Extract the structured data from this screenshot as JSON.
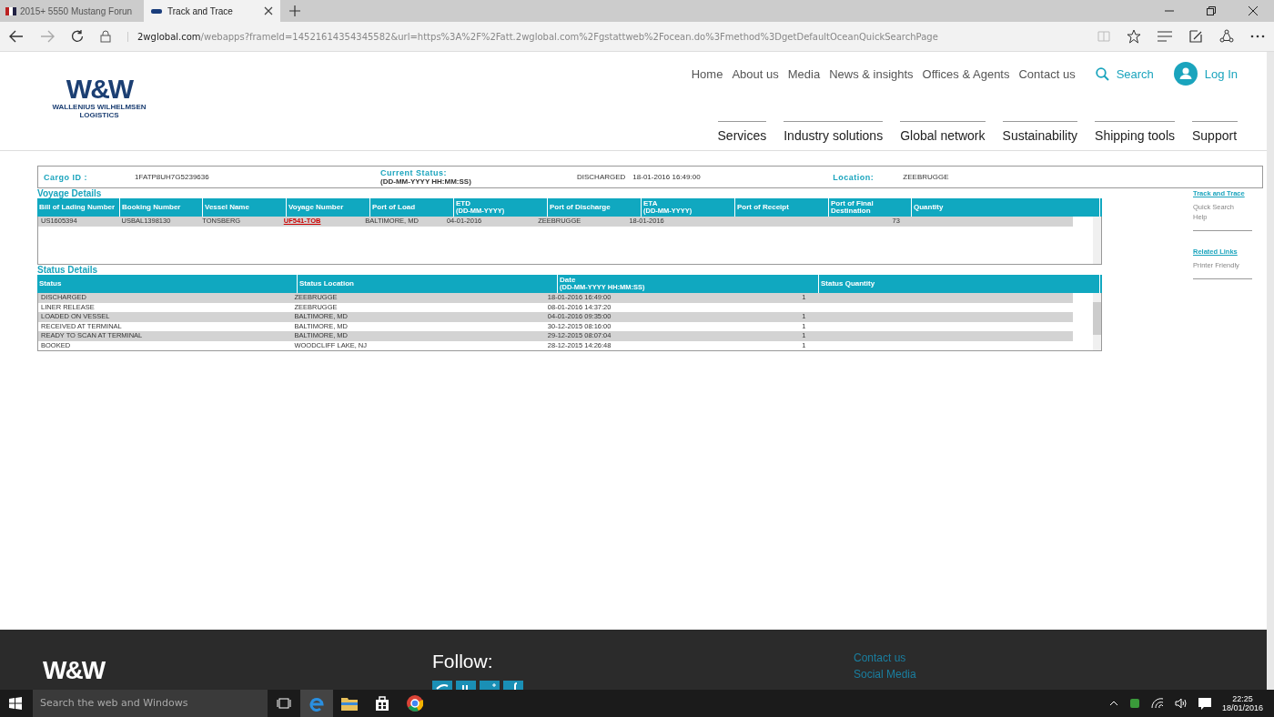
{
  "browser": {
    "tabs": [
      {
        "title": "2015+ 5550 Mustang Forun",
        "selected": false
      },
      {
        "title": "Track and Trace",
        "selected": true
      }
    ],
    "address": {
      "domain": "2wglobal.com",
      "path": "/webapps?frameId=14521614354345582&url=https%3A%2F%2Fatt.2wglobal.com%2Fgstattweb%2Focean.do%3Fmethod%3DgetDefaultOceanQuickSearchPage"
    }
  },
  "header": {
    "logo": {
      "mark": "W&W",
      "name": "WALLENIUS WILHELMSEN",
      "sub": "LOGISTICS"
    },
    "top_nav": [
      "Home",
      "About us",
      "Media",
      "News & insights",
      "Offices & Agents",
      "Contact us"
    ],
    "search": "Search",
    "login": "Log In",
    "main_nav": [
      "Services",
      "Industry solutions",
      "Global network",
      "Sustainability",
      "Shipping tools",
      "Support"
    ]
  },
  "summary": {
    "cargo_label": "Cargo ID :",
    "cargo_id": "1FATP8UH7G5239636",
    "status_label": "Current Status:",
    "status_format": "(DD-MM-YYYY HH:MM:SS)",
    "status": "DISCHARGED",
    "status_date": "18-01-2016 16:49:00",
    "location_label": "Location:",
    "location": "ZEEBRUGGE"
  },
  "voyage": {
    "title": "Voyage  Details",
    "columns": [
      {
        "label": "Bill of Lading Number"
      },
      {
        "label": "Booking  Number"
      },
      {
        "label": "Vessel  Name"
      },
      {
        "label": "Voyage  Number"
      },
      {
        "label": "Port of Load"
      },
      {
        "label": "ETD",
        "sub": "(DD-MM-YYYY)"
      },
      {
        "label": "Port of  Discharge"
      },
      {
        "label": "ETA",
        "sub": "(DD-MM-YYYY)"
      },
      {
        "label": "Port of  Receipt"
      },
      {
        "label": "Port of Final Destination"
      },
      {
        "label": "Quantity"
      }
    ],
    "rows": [
      [
        {
          "text": "US1605394"
        },
        {
          "text": "USBAL1398130"
        },
        {
          "text": "TONSBERG"
        },
        {
          "text": "UF541-TOB",
          "kind": "link"
        },
        {
          "text": "BALTIMORE, MD"
        },
        {
          "text": "04-01-2016"
        },
        {
          "text": "ZEEBRUGGE"
        },
        {
          "text": "18-01-2016"
        },
        {
          "text": ""
        },
        {
          "text": ""
        },
        {
          "text": "73"
        }
      ]
    ]
  },
  "status": {
    "title": "Status Details",
    "columns": [
      {
        "label": "Status"
      },
      {
        "label": "Status Location"
      },
      {
        "label": "Date",
        "sub": "(DD-MM-YYYY HH:MM:SS)"
      },
      {
        "label": "Status Quantity"
      }
    ],
    "rows": [
      [
        "DISCHARGED",
        "ZEEBRUGGE",
        "18-01-2016 16:49:00",
        "1"
      ],
      [
        "LINER RELEASE",
        "ZEEBRUGGE",
        "08-01-2016 14:37:20",
        ""
      ],
      [
        "LOADED ON VESSEL",
        "BALTIMORE, MD",
        "04-01-2016 09:35:00",
        "1"
      ],
      [
        "RECEIVED AT TERMINAL",
        "BALTIMORE, MD",
        "30-12-2015 08:16:00",
        "1"
      ],
      [
        "READY TO SCAN AT TERMINAL",
        "BALTIMORE, MD",
        "29-12-2015 08:07:04",
        "1"
      ],
      [
        "BOOKED",
        "WOODCLIFF LAKE, NJ",
        "28-12-2015 14:26:48",
        "1"
      ]
    ]
  },
  "sidebar": [
    {
      "title": "Track and Trace",
      "links": [
        "Quick Search",
        "Help"
      ]
    },
    {
      "title": "Related Links",
      "links": [
        "Printer Friendly"
      ]
    }
  ],
  "footer": {
    "logo": "W&W",
    "follow": "Follow:",
    "links": [
      "Contact us",
      "Social Media"
    ]
  },
  "taskbar": {
    "search": "Search the web and Windows",
    "time": "22:25",
    "date": "18/01/2016"
  }
}
